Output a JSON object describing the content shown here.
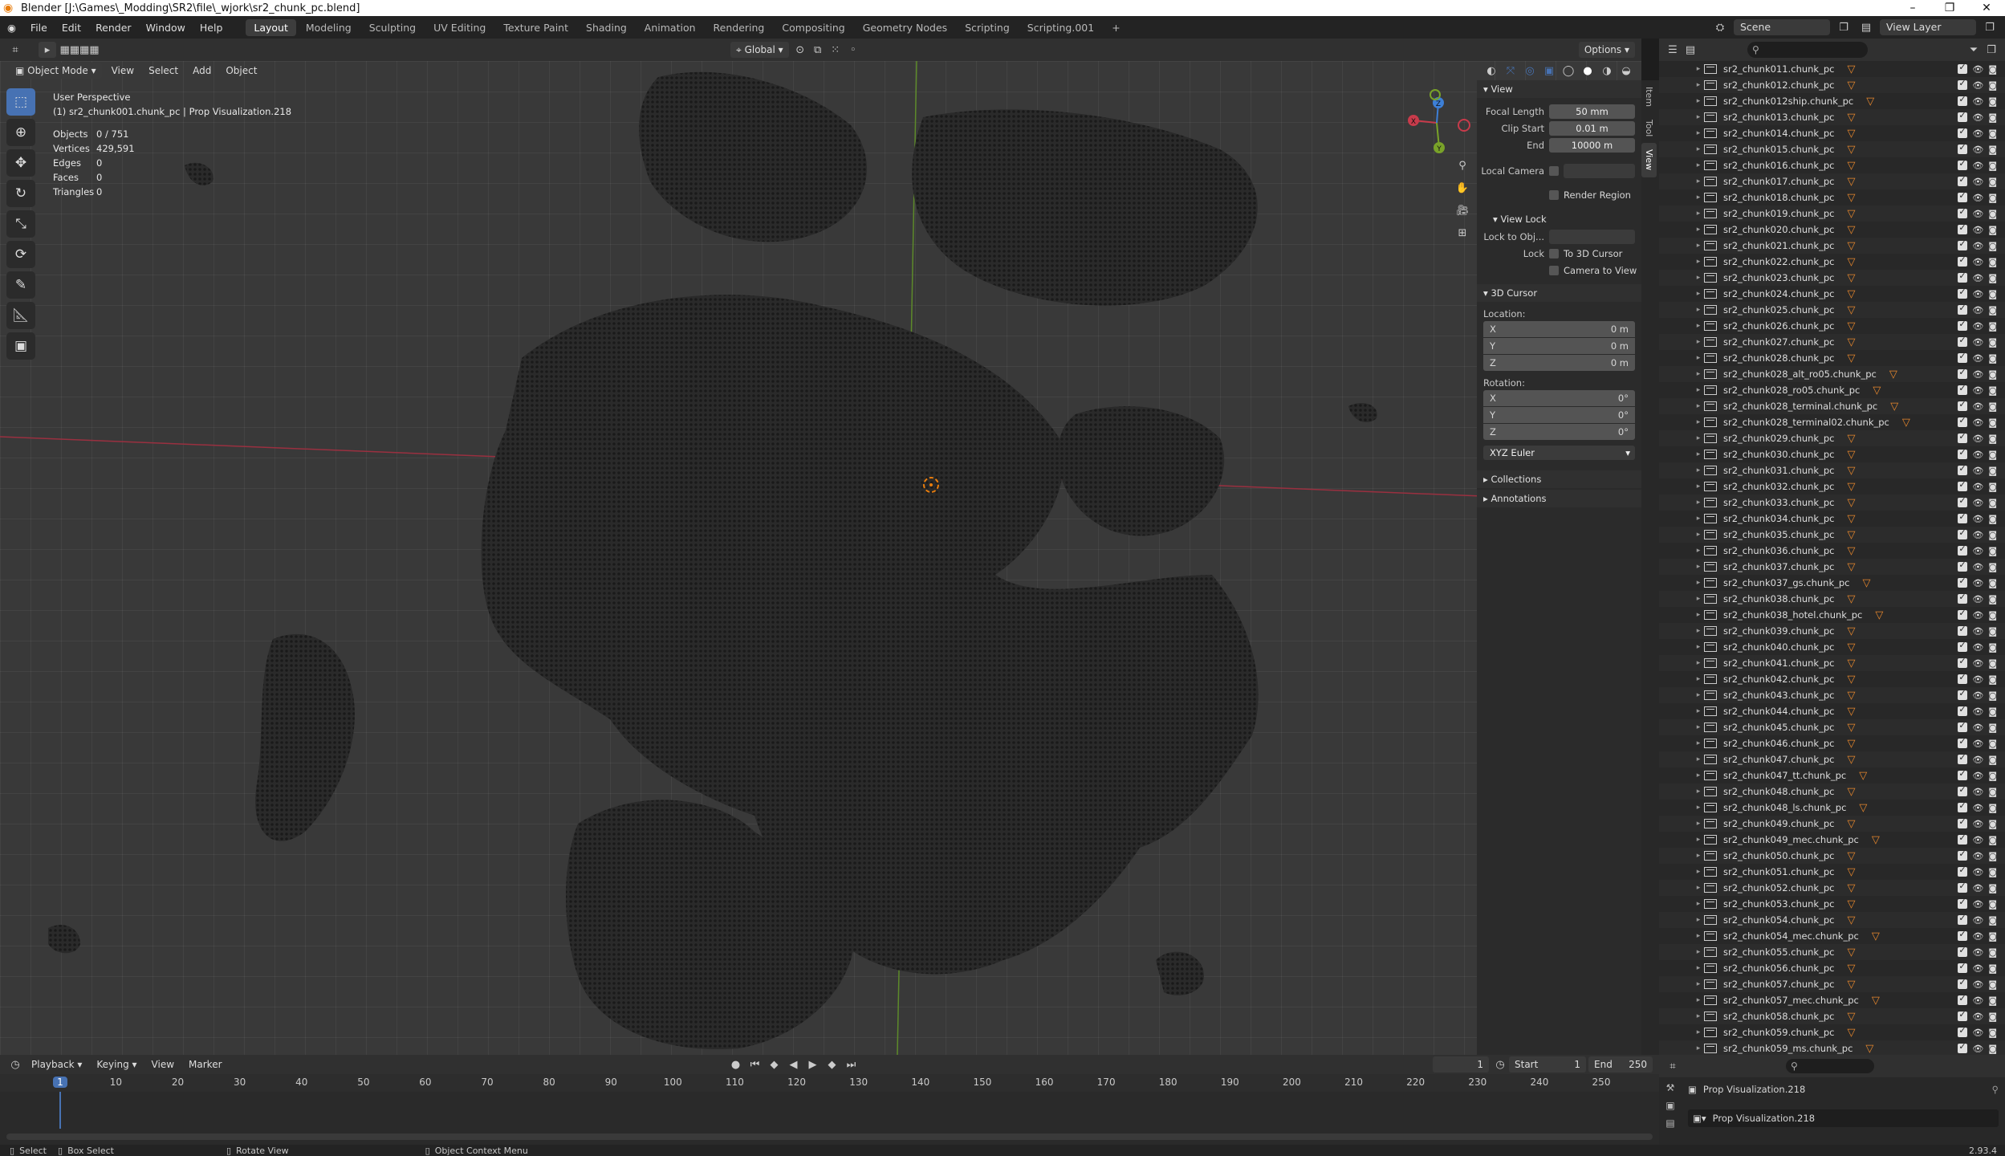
{
  "window": {
    "title": "Blender [J:\\Games\\_Modding\\SR2\\file\\_wjork\\sr2_chunk_pc.blend]"
  },
  "menu": [
    "File",
    "Edit",
    "Render",
    "Window",
    "Help"
  ],
  "workspaces": [
    "Layout",
    "Modeling",
    "Sculpting",
    "UV Editing",
    "Texture Paint",
    "Shading",
    "Animation",
    "Rendering",
    "Compositing",
    "Geometry Nodes",
    "Scripting",
    "Scripting.001"
  ],
  "active_workspace": "Layout",
  "scene": {
    "name": "Scene",
    "view_layer": "View Layer"
  },
  "viewport_header": {
    "mode": "Object Mode",
    "menus": [
      "View",
      "Select",
      "Add",
      "Object"
    ],
    "transform_orientation": "Global",
    "options_label": "Options"
  },
  "viewport": {
    "perspective_label": "User Perspective",
    "active_object_label": "(1) sr2_chunk001.chunk_pc | Prop Visualization.218",
    "stats": [
      {
        "label": "Objects",
        "value": "0 / 751"
      },
      {
        "label": "Vertices",
        "value": "429,591"
      },
      {
        "label": "Edges",
        "value": "0"
      },
      {
        "label": "Faces",
        "value": "0"
      },
      {
        "label": "Triangles",
        "value": "0"
      }
    ],
    "gizmo_axes": [
      "X",
      "Y",
      "Z"
    ]
  },
  "n_panel": {
    "view_section": "View",
    "focal_length_label": "Focal Length",
    "focal_length": "50 mm",
    "clip_start_label": "Clip Start",
    "clip_start": "0.01 m",
    "end_label": "End",
    "clip_end": "10000 m",
    "local_camera_label": "Local Camera",
    "render_region_label": "Render Region",
    "view_lock_section": "View Lock",
    "lock_to_obj_label": "Lock to Obj...",
    "lock_label": "Lock",
    "to_3d_cursor_label": "To 3D Cursor",
    "camera_to_view_label": "Camera to View",
    "cursor_section": "3D Cursor",
    "location_label": "Location:",
    "location": [
      {
        "axis": "X",
        "value": "0 m"
      },
      {
        "axis": "Y",
        "value": "0 m"
      },
      {
        "axis": "Z",
        "value": "0 m"
      }
    ],
    "rotation_label": "Rotation:",
    "rotation": [
      {
        "axis": "X",
        "value": "0°"
      },
      {
        "axis": "Y",
        "value": "0°"
      },
      {
        "axis": "Z",
        "value": "0°"
      }
    ],
    "rotation_mode": "XYZ Euler",
    "collections_section": "Collections",
    "annotations_section": "Annotations"
  },
  "side_tabs": [
    "Item",
    "Tool",
    "View"
  ],
  "outliner": {
    "items": [
      "sr2_chunk011.chunk_pc",
      "sr2_chunk012.chunk_pc",
      "sr2_chunk012ship.chunk_pc",
      "sr2_chunk013.chunk_pc",
      "sr2_chunk014.chunk_pc",
      "sr2_chunk015.chunk_pc",
      "sr2_chunk016.chunk_pc",
      "sr2_chunk017.chunk_pc",
      "sr2_chunk018.chunk_pc",
      "sr2_chunk019.chunk_pc",
      "sr2_chunk020.chunk_pc",
      "sr2_chunk021.chunk_pc",
      "sr2_chunk022.chunk_pc",
      "sr2_chunk023.chunk_pc",
      "sr2_chunk024.chunk_pc",
      "sr2_chunk025.chunk_pc",
      "sr2_chunk026.chunk_pc",
      "sr2_chunk027.chunk_pc",
      "sr2_chunk028.chunk_pc",
      "sr2_chunk028_alt_ro05.chunk_pc",
      "sr2_chunk028_ro05.chunk_pc",
      "sr2_chunk028_terminal.chunk_pc",
      "sr2_chunk028_terminal02.chunk_pc",
      "sr2_chunk029.chunk_pc",
      "sr2_chunk030.chunk_pc",
      "sr2_chunk031.chunk_pc",
      "sr2_chunk032.chunk_pc",
      "sr2_chunk033.chunk_pc",
      "sr2_chunk034.chunk_pc",
      "sr2_chunk035.chunk_pc",
      "sr2_chunk036.chunk_pc",
      "sr2_chunk037.chunk_pc",
      "sr2_chunk037_gs.chunk_pc",
      "sr2_chunk038.chunk_pc",
      "sr2_chunk038_hotel.chunk_pc",
      "sr2_chunk039.chunk_pc",
      "sr2_chunk040.chunk_pc",
      "sr2_chunk041.chunk_pc",
      "sr2_chunk042.chunk_pc",
      "sr2_chunk043.chunk_pc",
      "sr2_chunk044.chunk_pc",
      "sr2_chunk045.chunk_pc",
      "sr2_chunk046.chunk_pc",
      "sr2_chunk047.chunk_pc",
      "sr2_chunk047_tt.chunk_pc",
      "sr2_chunk048.chunk_pc",
      "sr2_chunk048_ls.chunk_pc",
      "sr2_chunk049.chunk_pc",
      "sr2_chunk049_mec.chunk_pc",
      "sr2_chunk050.chunk_pc",
      "sr2_chunk051.chunk_pc",
      "sr2_chunk052.chunk_pc",
      "sr2_chunk053.chunk_pc",
      "sr2_chunk054.chunk_pc",
      "sr2_chunk054_mec.chunk_pc",
      "sr2_chunk055.chunk_pc",
      "sr2_chunk056.chunk_pc",
      "sr2_chunk057.chunk_pc",
      "sr2_chunk057_mec.chunk_pc",
      "sr2_chunk058.chunk_pc",
      "sr2_chunk059.chunk_pc",
      "sr2_chunk059_ms.chunk_pc"
    ]
  },
  "properties": {
    "active_object": "Prop Visualization.218",
    "data_name": "Prop Visualization.218"
  },
  "timeline": {
    "menus": [
      "Playback",
      "Keying",
      "View",
      "Marker"
    ],
    "current_frame": "1",
    "start_label": "Start",
    "start": "1",
    "end_label": "End",
    "end": "250",
    "ticks": [
      "1",
      "10",
      "20",
      "30",
      "40",
      "50",
      "60",
      "70",
      "80",
      "90",
      "100",
      "110",
      "120",
      "130",
      "140",
      "150",
      "160",
      "170",
      "180",
      "190",
      "200",
      "210",
      "220",
      "230",
      "240",
      "250"
    ]
  },
  "statusbar": {
    "select": "Select",
    "box_select": "Box Select",
    "rotate_view": "Rotate View",
    "context_menu": "Object Context Menu",
    "version": "2.93.4"
  },
  "colors": {
    "accent": "#4772b3",
    "x_axis": "#c83b4b",
    "y_axis": "#79a229",
    "z_axis": "#3d7fd6",
    "cursor": "#e87d0d",
    "mesh_marker": "#e8882d"
  }
}
